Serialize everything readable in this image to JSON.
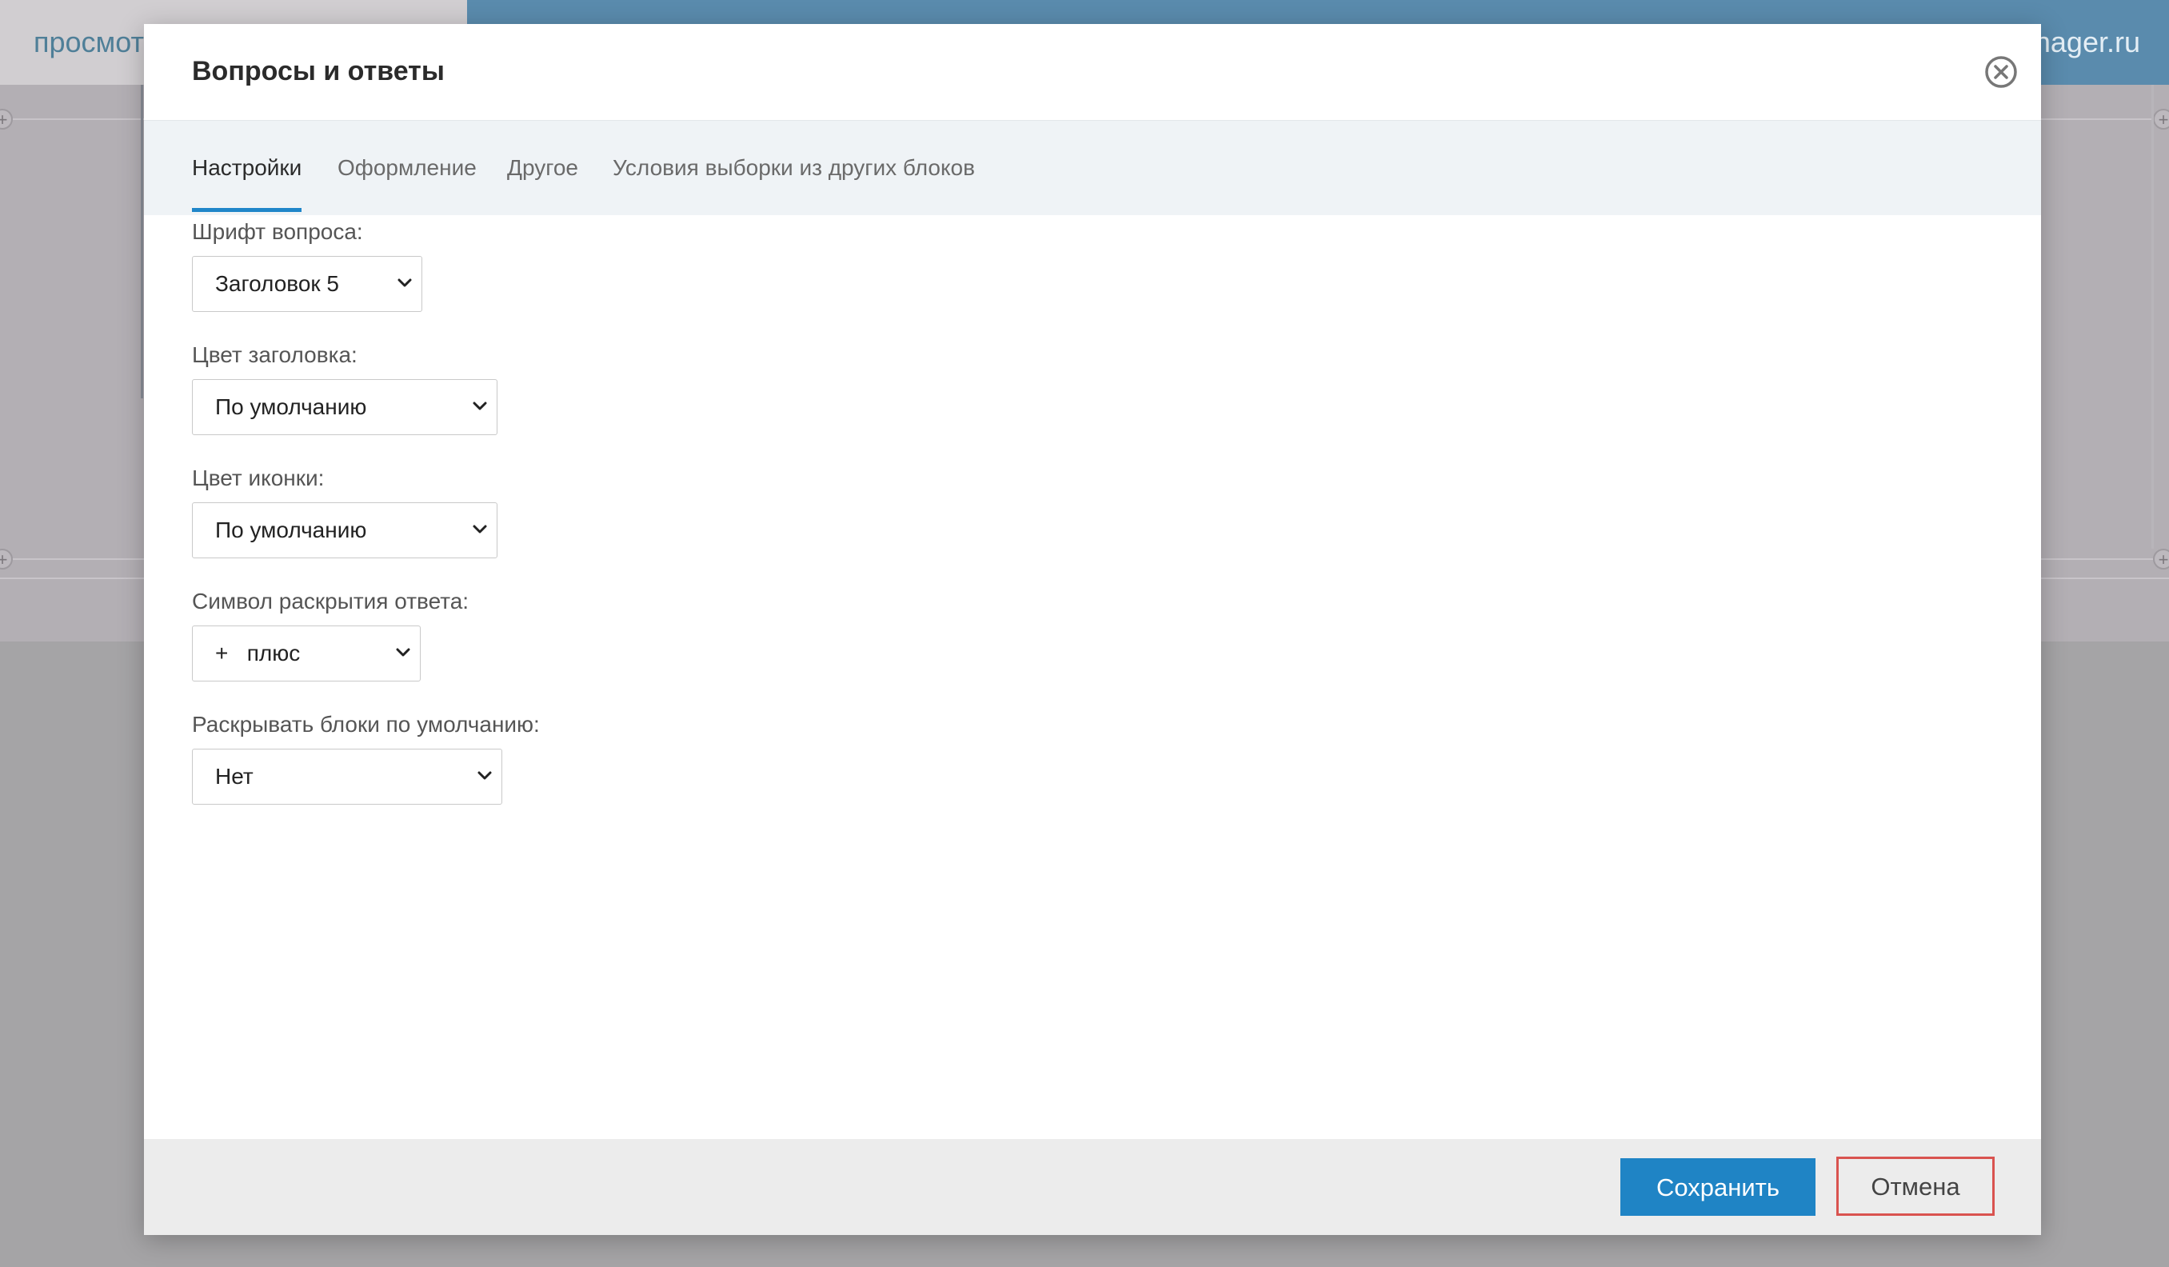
{
  "background": {
    "topbar_left_text": "просмот",
    "topbar_right_text": "nager.ru"
  },
  "modal": {
    "title": "Вопросы и ответы",
    "close_icon": "close-circle-icon",
    "tabs": [
      {
        "label": "Настройки",
        "active": true
      },
      {
        "label": "Оформление",
        "active": false
      },
      {
        "label": "Другое",
        "active": false
      },
      {
        "label": "Условия выборки из других блоков",
        "active": false
      }
    ],
    "fields": [
      {
        "label": "Шрифт вопроса:",
        "value": "Заголовок 5"
      },
      {
        "label": "Цвет заголовка:",
        "value": "По умолчанию"
      },
      {
        "label": "Цвет иконки:",
        "value": "По умолчанию"
      },
      {
        "label": "Символ раскрытия ответа:",
        "value": "+   плюс"
      },
      {
        "label": "Раскрывать блоки по умолчанию:",
        "value": "Нет"
      }
    ],
    "footer": {
      "save_label": "Сохранить",
      "cancel_label": "Отмена"
    }
  },
  "colors": {
    "accent": "#1f84c5",
    "cancel_border": "#d9534f",
    "overlay": "#b0acb1"
  }
}
